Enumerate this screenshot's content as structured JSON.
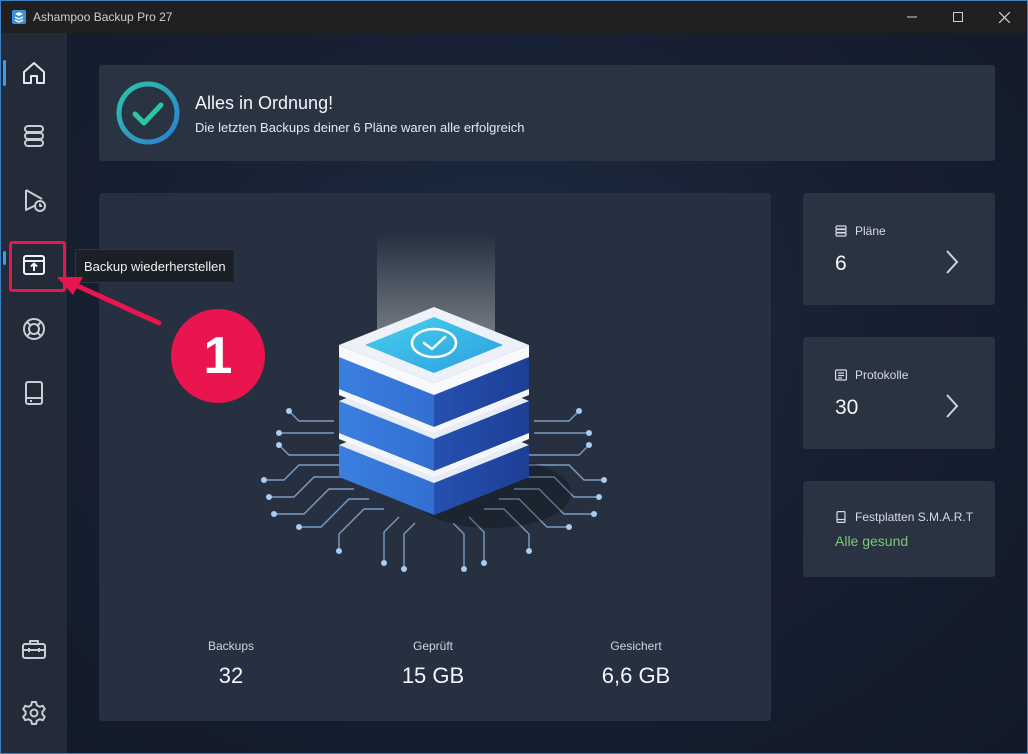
{
  "window": {
    "title": "Ashampoo Backup Pro 27"
  },
  "sidebar": {
    "items": [
      {
        "name": "home",
        "icon": "home-icon",
        "active": true
      },
      {
        "name": "plans",
        "icon": "database-icon"
      },
      {
        "name": "run",
        "icon": "play-clock-icon"
      },
      {
        "name": "restore",
        "icon": "restore-box-icon",
        "tooltip": "Backup wiederherstellen"
      },
      {
        "name": "rescue",
        "icon": "lifebuoy-icon"
      },
      {
        "name": "drives",
        "icon": "drive-icon"
      },
      {
        "name": "tools",
        "icon": "toolbox-icon"
      },
      {
        "name": "settings",
        "icon": "gear-icon"
      }
    ]
  },
  "tooltip": {
    "text": "Backup wiederherstellen"
  },
  "annotation": {
    "step_number": "1",
    "accent_color": "#e8154e"
  },
  "status": {
    "title": "Alles in Ordnung!",
    "subtitle": "Die letzten Backups deiner 6 Pläne waren alle erfolgreich"
  },
  "stats": [
    {
      "label": "Backups",
      "value": "32"
    },
    {
      "label": "Geprüft",
      "value": "15 GB"
    },
    {
      "label": "Gesichert",
      "value": "6,6 GB"
    }
  ],
  "cards": {
    "plans": {
      "label": "Pläne",
      "value": "6"
    },
    "logs": {
      "label": "Protokolle",
      "value": "30"
    },
    "smart": {
      "label": "Festplatten S.M.A.R.T",
      "status": "Alle gesund"
    }
  },
  "colors": {
    "accent_blue": "#3c9ee8",
    "success_green": "#7dc87a",
    "check_gradient_start": "#2ec4a6",
    "check_gradient_end": "#2a7fd4"
  }
}
